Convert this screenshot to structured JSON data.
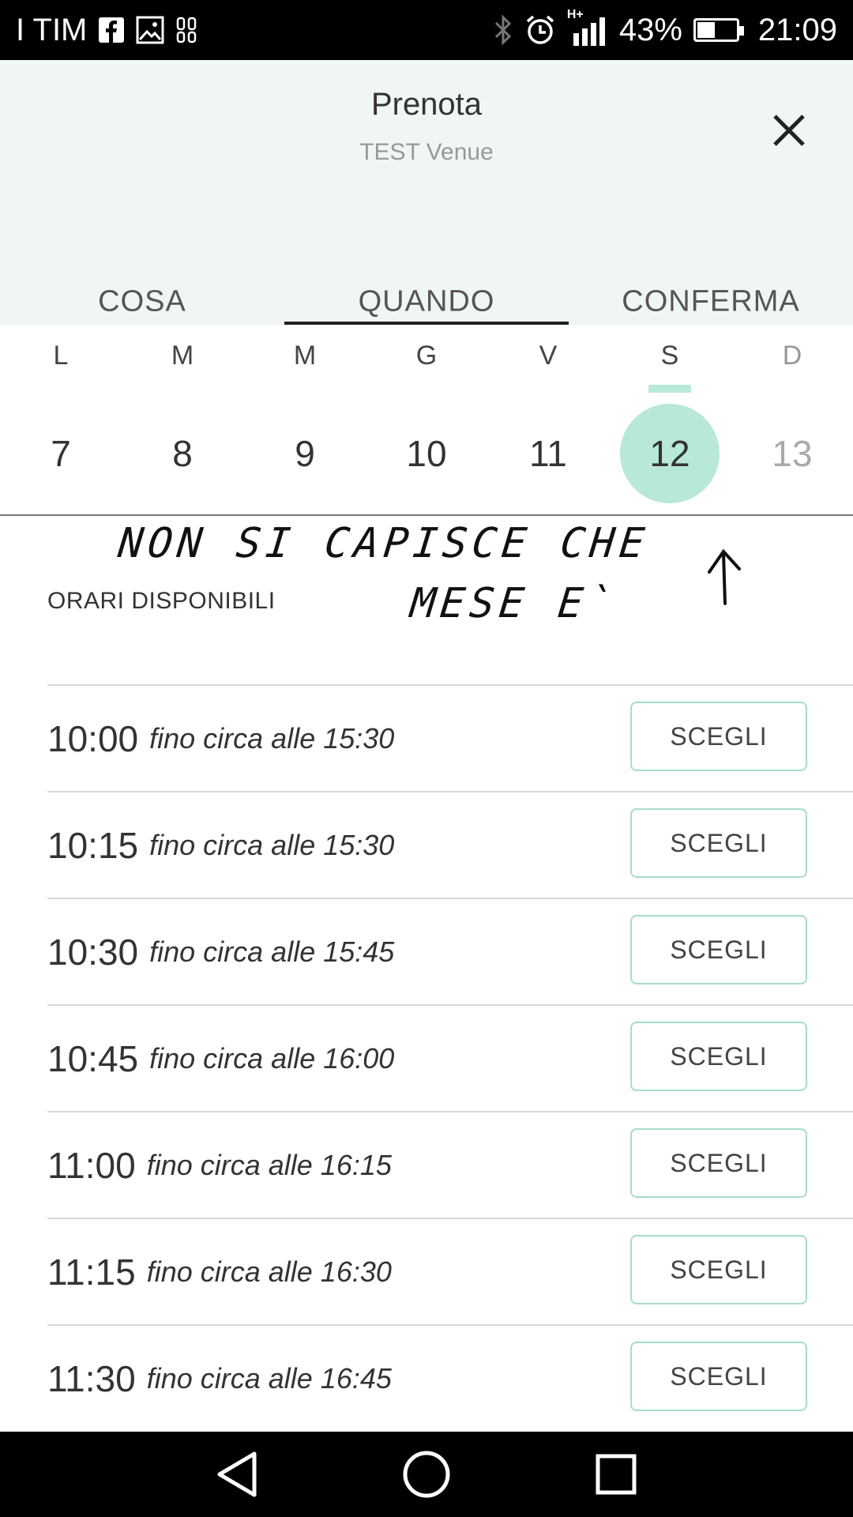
{
  "status_bar": {
    "carrier": "I TIM",
    "network": "H+",
    "battery_percent_text": "43%",
    "battery_level": 0.43,
    "time": "21:09"
  },
  "header": {
    "title": "Prenota",
    "subtitle": "TEST Venue"
  },
  "tabs": [
    {
      "label": "COSA",
      "active": false
    },
    {
      "label": "QUANDO",
      "active": true
    },
    {
      "label": "CONFERMA",
      "active": false
    }
  ],
  "calendar": {
    "days": [
      {
        "letter": "L",
        "number": "7"
      },
      {
        "letter": "M",
        "number": "8"
      },
      {
        "letter": "M",
        "number": "9"
      },
      {
        "letter": "G",
        "number": "10"
      },
      {
        "letter": "V",
        "number": "11"
      },
      {
        "letter": "S",
        "number": "12",
        "selected": true
      },
      {
        "letter": "D",
        "number": "13",
        "disabled": true
      }
    ]
  },
  "annotation": {
    "line1": "NON SI CAPISCE CHE",
    "line2": "MESE E`"
  },
  "section_label": "ORARI DISPONIBILI",
  "slots": [
    {
      "time": "10:00",
      "until": "fino circa alle 15:30",
      "button": "SCEGLI"
    },
    {
      "time": "10:15",
      "until": "fino circa alle 15:30",
      "button": "SCEGLI"
    },
    {
      "time": "10:30",
      "until": "fino circa alle 15:45",
      "button": "SCEGLI"
    },
    {
      "time": "10:45",
      "until": "fino circa alle 16:00",
      "button": "SCEGLI"
    },
    {
      "time": "11:00",
      "until": "fino circa alle 16:15",
      "button": "SCEGLI"
    },
    {
      "time": "11:15",
      "until": "fino circa alle 16:30",
      "button": "SCEGLI"
    },
    {
      "time": "11:30",
      "until": "fino circa alle 16:45",
      "button": "SCEGLI"
    }
  ],
  "colors": {
    "accent": "#b8e8d6",
    "button_border": "#a8dcc8",
    "header_bg": "#f0f5f5"
  }
}
